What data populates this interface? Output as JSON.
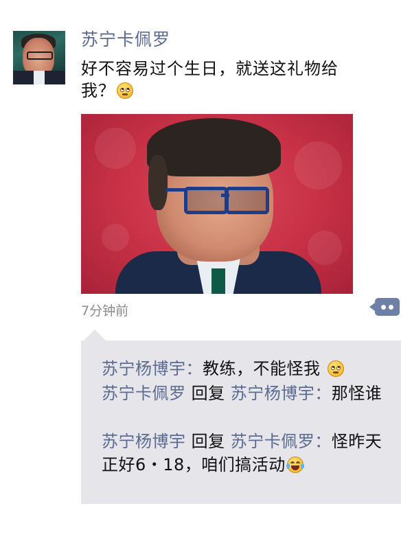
{
  "post": {
    "author": "苏宁卡佩罗",
    "text": "好不容易过个生日，就送这礼物给我？",
    "text_emoji": "rolling-eyes-emoji",
    "time": "7分钟前"
  },
  "comments": [
    {
      "author": "苏宁杨博宇",
      "separator": "：",
      "text": "教练，不能怪我",
      "emoji": "rolling-eyes-emoji"
    },
    {
      "author": "苏宁卡佩罗",
      "reply_word": "回复",
      "reply_to": "苏宁杨博宇",
      "separator": "：",
      "text": "那怪谁"
    },
    {
      "author": "苏宁杨博宇",
      "reply_word": "回复",
      "reply_to": "苏宁卡佩罗",
      "separator": "：",
      "text": "怪昨天正好6・18，咱们搞活动",
      "emoji": "tears-of-joy-emoji"
    }
  ],
  "colors": {
    "name": "#5b6b8f",
    "comment_bg": "#e5e5ea",
    "photo_bg": "#c93247"
  }
}
